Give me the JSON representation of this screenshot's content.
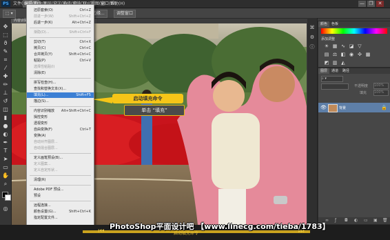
{
  "app": {
    "logo": "PS"
  },
  "menubar": {
    "items": [
      "文件(F)",
      "编辑(E)",
      "图像(I)",
      "图层(L)",
      "文字(Y)",
      "选择(S)",
      "滤镜(T)",
      "3D(D)",
      "视图(V)",
      "窗口(W)",
      "帮助(H)"
    ],
    "active_index": 1
  },
  "window_buttons": [
    "—",
    "❐",
    "✕"
  ],
  "options_bar": {
    "btn1": "调整边缘...",
    "btn2": "调整窗口"
  },
  "document": {
    "tab": "内容识别填充.jpg @ 66.7%"
  },
  "edit_menu": {
    "items": [
      {
        "label": "还原套索(O)",
        "shortcut": "Ctrl+Z",
        "state": "normal"
      },
      {
        "label": "前进一步(W)",
        "shortcut": "Shift+Ctrl+Z",
        "state": "dim"
      },
      {
        "label": "后退一步(K)",
        "shortcut": "Alt+Ctrl+Z",
        "state": "normal"
      },
      {
        "label": "渐隐(D)...",
        "shortcut": "Shift+Ctrl+F",
        "state": "dim"
      },
      {
        "label": "剪切(T)",
        "shortcut": "Ctrl+X",
        "state": "normal"
      },
      {
        "label": "拷贝(C)",
        "shortcut": "Ctrl+C",
        "state": "normal"
      },
      {
        "label": "合并拷贝(Y)",
        "shortcut": "Shift+Ctrl+C",
        "state": "normal"
      },
      {
        "label": "粘贴(P)",
        "shortcut": "Ctrl+V",
        "state": "normal"
      },
      {
        "label": "选择性粘贴(I)",
        "shortcut": "",
        "state": "dim"
      },
      {
        "label": "清除(E)",
        "shortcut": "",
        "state": "normal"
      },
      {
        "label": "拼写检查(H)...",
        "shortcut": "",
        "state": "normal"
      },
      {
        "label": "查找和替换文本(X)...",
        "shortcut": "",
        "state": "normal"
      },
      {
        "label": "填充(L)...",
        "shortcut": "Shift+F5",
        "state": "highlight"
      },
      {
        "label": "描边(S)...",
        "shortcut": "",
        "state": "normal"
      },
      {
        "label": "内容识别缩放",
        "shortcut": "Alt+Shift+Ctrl+C",
        "state": "normal"
      },
      {
        "label": "操控变形",
        "shortcut": "",
        "state": "normal"
      },
      {
        "label": "透视变形",
        "shortcut": "",
        "state": "normal"
      },
      {
        "label": "自由变换(F)",
        "shortcut": "Ctrl+T",
        "state": "normal"
      },
      {
        "label": "变换(A)",
        "shortcut": "",
        "state": "normal"
      },
      {
        "label": "自动对齐图层...",
        "shortcut": "",
        "state": "dim"
      },
      {
        "label": "自动混合图层...",
        "shortcut": "",
        "state": "dim"
      },
      {
        "label": "定义画笔预设(B)...",
        "shortcut": "",
        "state": "normal"
      },
      {
        "label": "定义图案...",
        "shortcut": "",
        "state": "dim"
      },
      {
        "label": "定义自定形状...",
        "shortcut": "",
        "state": "dim"
      },
      {
        "label": "清理(R)",
        "shortcut": "",
        "state": "normal"
      },
      {
        "label": "Adobe PDF 预设...",
        "shortcut": "",
        "state": "normal"
      },
      {
        "label": "预设",
        "shortcut": "",
        "state": "normal"
      },
      {
        "label": "远程连接...",
        "shortcut": "",
        "state": "normal"
      },
      {
        "label": "颜色设置(G)...",
        "shortcut": "Shift+Ctrl+K",
        "state": "normal"
      },
      {
        "label": "指定配置文件...",
        "shortcut": "",
        "state": "normal"
      }
    ]
  },
  "callouts": {
    "primary": "启动填充命令",
    "secondary": "单击 “填充”"
  },
  "panels": {
    "adjust_tabs": [
      "颜色",
      "色板"
    ],
    "adjust_title": "添加调整",
    "layers_tabs": [
      "图层",
      "通道",
      "路径"
    ],
    "layer_name": "背景",
    "opacity_label": "不透明度",
    "opacity_value": "100%",
    "fill_label": "填充",
    "fill_value": "100%"
  },
  "watermark": "PhotoShop平面设计吧 【www.linecg.com/tieba/1783】",
  "bottom_caption": "启动填充命令"
}
